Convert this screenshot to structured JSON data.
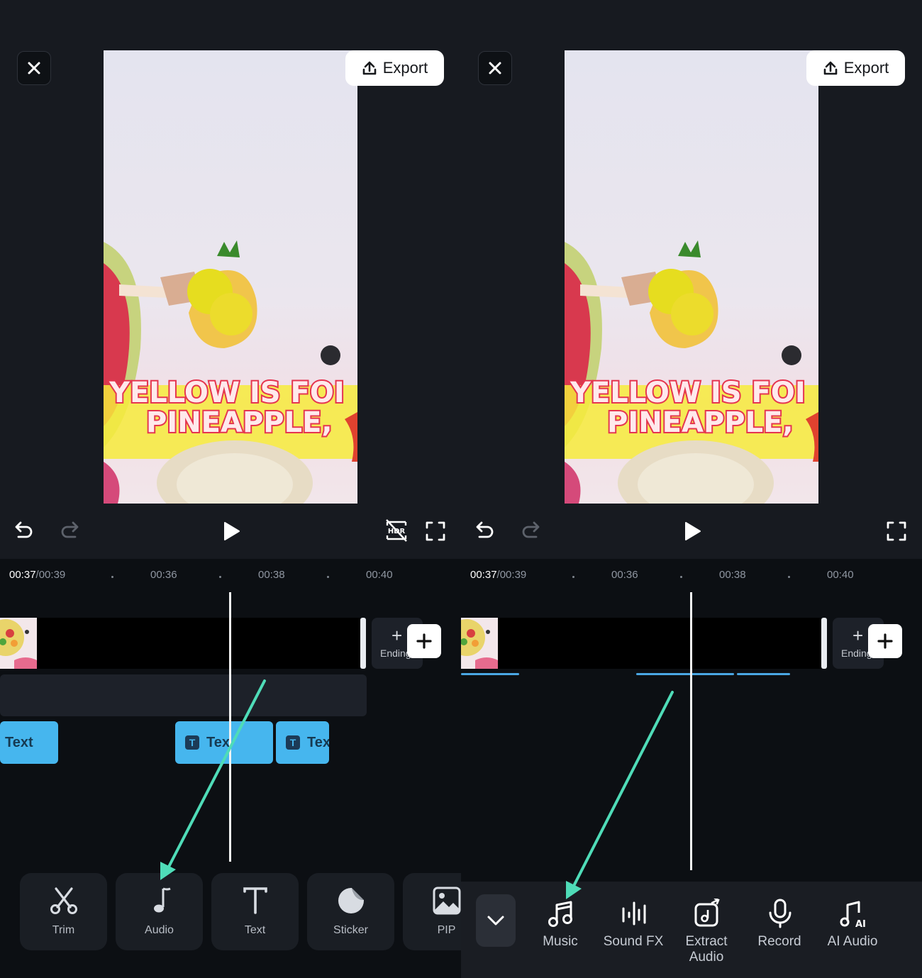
{
  "header": {
    "export_label": "Export"
  },
  "preview": {
    "caption_line1": "YELLOW IS FOI",
    "caption_line2": "PINEAPPLE,"
  },
  "timeline": {
    "current_time": "00:37",
    "total_time": "/00:39",
    "ticks": [
      "00:36",
      "00:38",
      "00:40"
    ],
    "ending_label": "Ending"
  },
  "text_track": {
    "clips": [
      "Text",
      "Tex",
      "Tex"
    ]
  },
  "toolbar": {
    "tools": [
      {
        "label": "Trim",
        "icon": "scissors-icon"
      },
      {
        "label": "Audio",
        "icon": "music-note-icon"
      },
      {
        "label": "Text",
        "icon": "text-icon"
      },
      {
        "label": "Sticker",
        "icon": "sticker-icon"
      },
      {
        "label": "PIP",
        "icon": "image-icon"
      }
    ]
  },
  "audio_menu": {
    "items": [
      {
        "label": "Music",
        "icon": "music-icon"
      },
      {
        "label": "Sound FX",
        "icon": "soundwave-icon"
      },
      {
        "label": "Extract\nAudio",
        "icon": "extract-audio-icon"
      },
      {
        "label": "Record",
        "icon": "microphone-icon"
      },
      {
        "label": "AI Audio",
        "icon": "ai-audio-icon"
      }
    ]
  },
  "colors": {
    "accent": "#46b6ee",
    "annotation_arrow": "#4fdcb8",
    "background": "#0c0f13"
  }
}
